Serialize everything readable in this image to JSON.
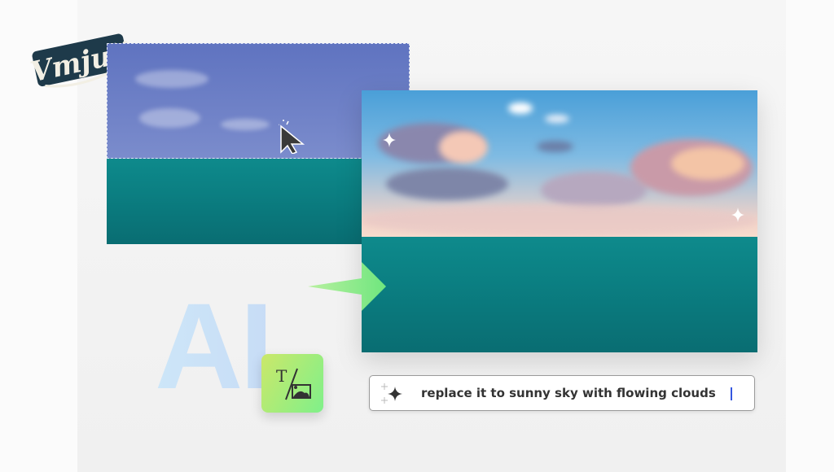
{
  "brand": {
    "logo_text": "Vmjuii"
  },
  "editor": {
    "ai_label": "AI",
    "tool_icon": "text-to-image-icon",
    "prompt": {
      "icon": "sparkle-icon",
      "value": "replace it to sunny sky with flowing clouds"
    }
  },
  "colors": {
    "accent": "#3557e0",
    "arrow": "#7ee787",
    "sea": "#0b7f82"
  }
}
